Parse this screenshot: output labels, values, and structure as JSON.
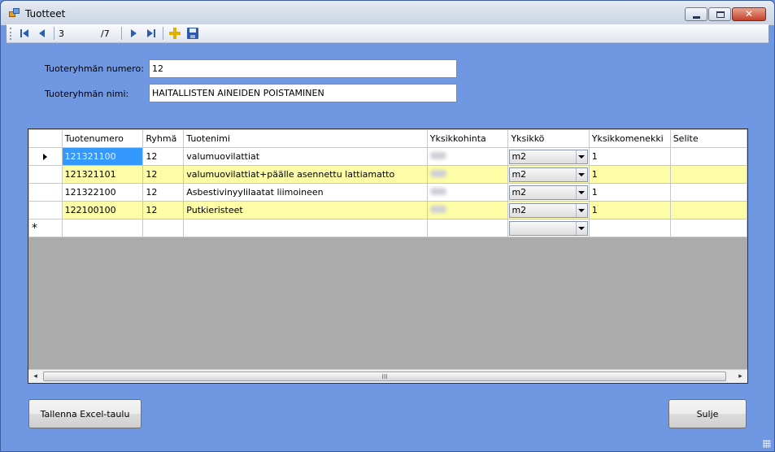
{
  "window": {
    "title": "Tuotteet"
  },
  "navigator": {
    "position": "3",
    "total": "/7"
  },
  "form": {
    "group_number_label": "Tuoteryhmän numero:",
    "group_number_value": "12",
    "group_name_label": "Tuoteryhmän nimi:",
    "group_name_value": "HAITALLISTEN AINEIDEN POISTAMINEN"
  },
  "grid": {
    "columns": [
      "Tuotenumero",
      "Ryhmä",
      "Tuotenimi",
      "Yksikkohinta",
      "Yksikkö",
      "Yksikkomenekki",
      "Selite"
    ],
    "rows": [
      {
        "tuotenumero": "121321100",
        "ryhma": "12",
        "tuotenimi": "valumuovilattiat",
        "yksikko": "m2",
        "menekki": "1",
        "selite": ""
      },
      {
        "tuotenumero": "121321101",
        "ryhma": "12",
        "tuotenimi": "valumuovilattiat+päälle asennettu lattiamatto",
        "yksikko": "m2",
        "menekki": "1",
        "selite": ""
      },
      {
        "tuotenumero": "121322100",
        "ryhma": "12",
        "tuotenimi": "Asbestivinyylilaatat liimoineen",
        "yksikko": "m2",
        "menekki": "1",
        "selite": ""
      },
      {
        "tuotenumero": "122100100",
        "ryhma": "12",
        "tuotenimi": "Putkieristeet",
        "yksikko": "m2",
        "menekki": "1",
        "selite": ""
      }
    ],
    "new_row_marker": "*",
    "scroll_thumb_grip": "III"
  },
  "buttons": {
    "save_excel": "Tallenna Excel-taulu",
    "close": "Sulje"
  },
  "colors": {
    "form_background": "#7098e2",
    "alt_row": "#fdfda8",
    "selected_cell": "#3399ff"
  }
}
